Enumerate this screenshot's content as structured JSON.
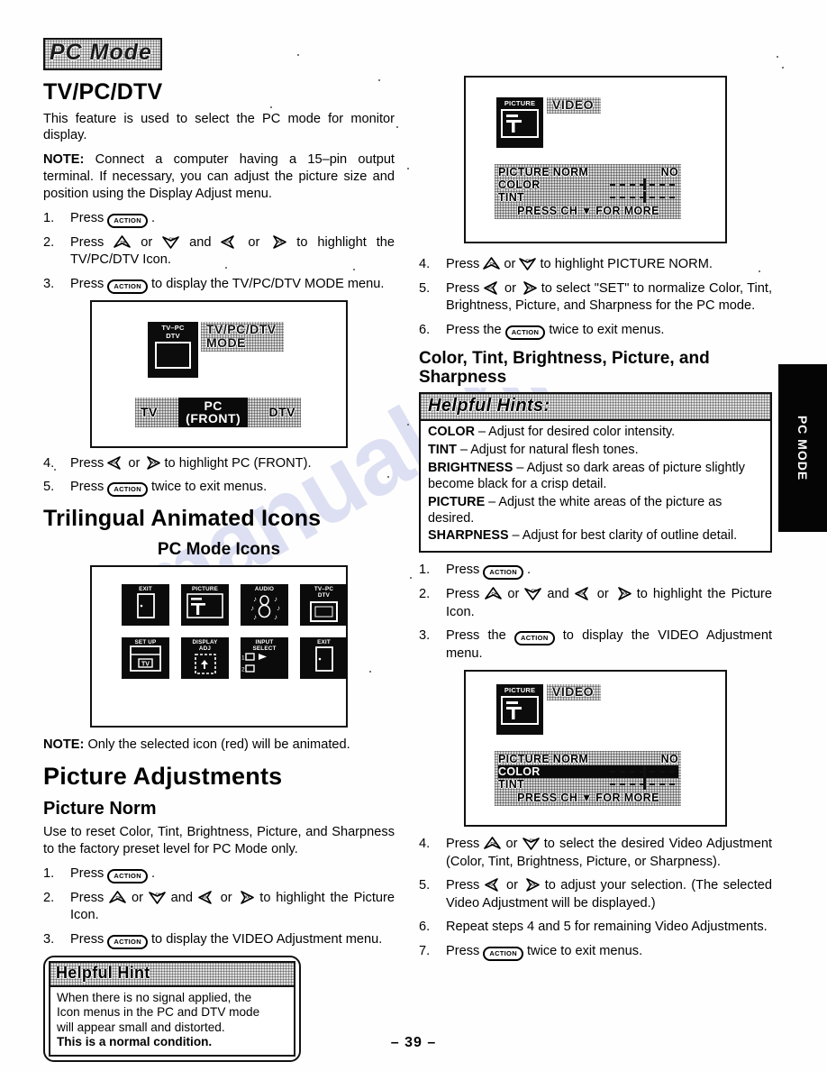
{
  "page": {
    "number": "– 39 –",
    "side_tab": "PC MODE",
    "watermark": "manualshive.com"
  },
  "left": {
    "section_banner": "PC Mode",
    "tv_pc_dtv": {
      "heading": "TV/PC/DTV",
      "intro": "This feature is used to select the PC mode for monitor display.",
      "note_label": "NOTE:",
      "note_text": " Connect a computer having a 15–pin output terminal. If necessary, you can adjust the picture size and position using the Display Adjust menu.",
      "steps": [
        {
          "num": "1.",
          "parts": [
            "Press ",
            "[ACTION]",
            " ."
          ]
        },
        {
          "num": "2.",
          "parts": [
            "Press ",
            "[UP]",
            " or ",
            "[DOWN]",
            " and ",
            "[LEFT]",
            " or ",
            "[RIGHT]",
            " to highlight the TV/PC/DTV Icon."
          ]
        },
        {
          "num": "3.",
          "parts": [
            "Press ",
            "[ACTION]",
            " to display the TV/PC/DTV MODE menu."
          ]
        }
      ],
      "steps_after": [
        {
          "num": "4.",
          "parts": [
            "Press ",
            "[LEFT]",
            " or ",
            "[RIGHT]",
            " to highlight PC (FRONT)."
          ]
        },
        {
          "num": "5.",
          "parts": [
            "Press ",
            "[ACTION]",
            " twice to exit menus."
          ]
        }
      ]
    },
    "screen_tvpcdtv": {
      "icon_caption": "TV–PC\nDTV",
      "menu_label_line1": "TV/PC/DTV",
      "menu_label_line2": "MODE",
      "selector": {
        "left_option": "TV",
        "selected_line1": "PC",
        "selected_line2": "(FRONT)",
        "right_option": "DTV"
      }
    },
    "trilingual": {
      "heading": "Trilingual Animated Icons",
      "subheading": "PC Mode Icons",
      "icons": [
        {
          "name": "EXIT",
          "glyph": "door"
        },
        {
          "name": "PICTURE",
          "glyph": "picture"
        },
        {
          "name": "AUDIO",
          "glyph": "audio"
        },
        {
          "name": "TV–PC\nDTV",
          "glyph": "monitor"
        },
        {
          "name": "SET UP",
          "glyph": "setup"
        },
        {
          "name": "DISPLAY\nADJ",
          "glyph": "display-adj"
        },
        {
          "name": "INPUT\nSELECT",
          "glyph": "input-select"
        },
        {
          "name": "EXIT",
          "glyph": "door"
        }
      ],
      "note_label": "NOTE:",
      "note_text": " Only the selected icon (red) will be animated."
    },
    "picture_adjustments": {
      "heading": "Picture Adjustments",
      "subheading": "Picture Norm",
      "intro": "Use to reset Color, Tint, Brightness, Picture, and Sharpness to the factory preset level for PC Mode only.",
      "steps": [
        {
          "num": "1.",
          "parts": [
            "Press ",
            "[ACTION]",
            " ."
          ]
        },
        {
          "num": "2.",
          "parts": [
            "Press ",
            "[UP]",
            " or ",
            "[DOWN]",
            " and ",
            "[LEFT]",
            " or ",
            "[RIGHT]",
            " to highlight the Picture Icon."
          ]
        },
        {
          "num": "3.",
          "parts": [
            "Press ",
            "[ACTION]",
            " to display the VIDEO Adjustment menu."
          ]
        }
      ]
    },
    "helpful_hint": {
      "title": "Helpful Hint",
      "lines": [
        "When there is no signal applied, the",
        "Icon menus in the PC and DTV mode",
        "will appear small and distorted."
      ],
      "bold_line": "This is a normal condition."
    }
  },
  "right": {
    "screen_video_1": {
      "icon_caption": "PICTURE",
      "menu_label": "VIDEO",
      "rows": [
        {
          "name": "PICTURE NORM",
          "value": "NO",
          "type": "value",
          "selected": false
        },
        {
          "name": "COLOR",
          "type": "slider",
          "selected": false
        },
        {
          "name": "TINT",
          "type": "slider",
          "selected": false
        }
      ],
      "footer_before": "PRESS CH ",
      "footer_tri": "▼",
      "footer_after": " FOR MORE"
    },
    "steps_norm": [
      {
        "num": "4.",
        "parts": [
          "Press ",
          "[UP]",
          " or ",
          "[DOWN]",
          " to highlight PICTURE NORM."
        ]
      },
      {
        "num": "5.",
        "parts": [
          "Press ",
          "[LEFT]",
          " or ",
          "[RIGHT]",
          " to select \"SET\" to normalize Color, Tint, Brightness, Picture, and Sharpness for the PC mode."
        ]
      },
      {
        "num": "6.",
        "parts": [
          "Press the ",
          "[ACTION]",
          " twice to exit menus."
        ]
      }
    ],
    "ctbps": {
      "heading": "Color, Tint, Brightness, Picture, and Sharpness",
      "hints_title": "Helpful Hints:",
      "hints": [
        {
          "term": "COLOR",
          "desc": " – Adjust for desired color intensity."
        },
        {
          "term": "TINT",
          "desc": " – Adjust for natural flesh tones."
        },
        {
          "term": "BRIGHTNESS",
          "desc": " – Adjust so dark areas of picture slightly become black for a crisp detail."
        },
        {
          "term": "PICTURE",
          "desc": " – Adjust the white areas of the picture as desired."
        },
        {
          "term": "SHARPNESS",
          "desc": " – Adjust for best clarity of outline detail."
        }
      ],
      "steps": [
        {
          "num": "1.",
          "parts": [
            "Press ",
            "[ACTION]",
            " ."
          ]
        },
        {
          "num": "2.",
          "parts": [
            "Press ",
            "[UP]",
            " or ",
            "[DOWN]",
            " and ",
            "[LEFT]",
            " or ",
            "[RIGHT]",
            " to highlight the Picture Icon."
          ]
        },
        {
          "num": "3.",
          "parts": [
            "Press the ",
            "[ACTION]",
            " to display the VIDEO Adjustment menu."
          ]
        }
      ]
    },
    "screen_video_2": {
      "icon_caption": "PICTURE",
      "menu_label": "VIDEO",
      "rows": [
        {
          "name": "PICTURE NORM",
          "value": "NO",
          "type": "value",
          "selected": false
        },
        {
          "name": "COLOR",
          "type": "slider",
          "selected": true
        },
        {
          "name": "TINT",
          "type": "slider",
          "selected": false
        }
      ],
      "footer_before": "PRESS CH ",
      "footer_tri": "▼",
      "footer_after": " FOR MORE"
    },
    "steps_adjust": [
      {
        "num": "4.",
        "parts": [
          "Press ",
          "[UP]",
          " or ",
          "[DOWN]",
          " to select the desired Video Adjustment (Color, Tint, Brightness, Picture, or Sharpness)."
        ]
      },
      {
        "num": "5.",
        "parts": [
          "Press ",
          "[LEFT]",
          " or ",
          "[RIGHT]",
          " to adjust your selection.  (The selected Video Adjustment will be displayed.)"
        ]
      },
      {
        "num": "6.",
        "parts": [
          "Repeat steps 4 and 5 for remaining Video Adjustments."
        ]
      },
      {
        "num": "7.",
        "parts": [
          "Press ",
          "[ACTION]",
          " twice to exit menus."
        ]
      }
    ]
  }
}
